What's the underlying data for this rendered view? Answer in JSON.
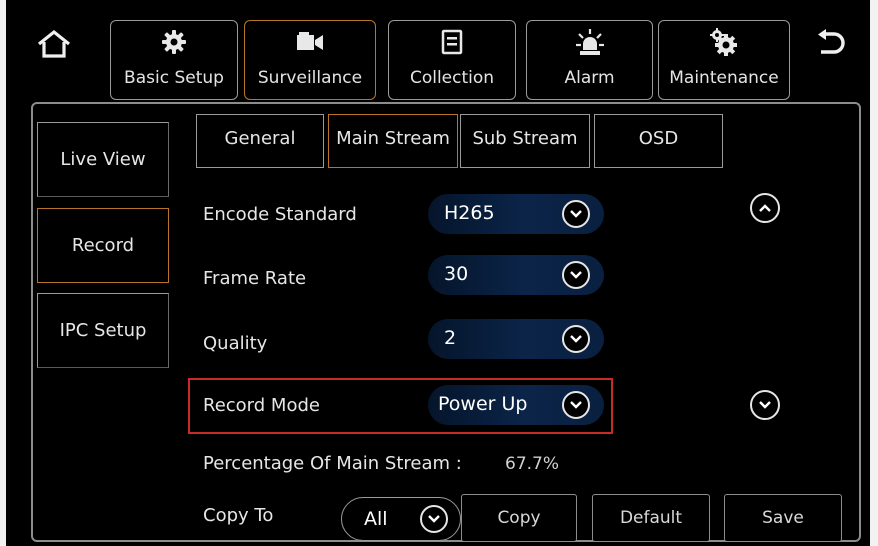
{
  "toolbar": {
    "tabs": [
      {
        "label": "Basic Setup",
        "icon": "gear-icon"
      },
      {
        "label": "Surveillance",
        "icon": "camera-icon"
      },
      {
        "label": "Collection",
        "icon": "document-icon"
      },
      {
        "label": "Alarm",
        "icon": "alarm-light-icon"
      },
      {
        "label": "Maintenance",
        "icon": "gears-icon"
      }
    ],
    "active_tab": "Surveillance"
  },
  "sidebar": {
    "items": [
      {
        "label": "Live View"
      },
      {
        "label": "Record"
      },
      {
        "label": "IPC Setup"
      }
    ],
    "active": "Record"
  },
  "subtabs": [
    {
      "label": "General"
    },
    {
      "label": "Main Stream"
    },
    {
      "label": "Sub Stream"
    },
    {
      "label": "OSD"
    }
  ],
  "active_subtab": "Main Stream",
  "settings": {
    "encode_standard": {
      "label": "Encode Standard",
      "value": "H265"
    },
    "frame_rate": {
      "label": "Frame Rate",
      "value": "30"
    },
    "quality": {
      "label": "Quality",
      "value": "2"
    },
    "record_mode": {
      "label": "Record Mode",
      "value": "Power Up"
    },
    "percentage_label": "Percentage Of Main Stream :",
    "percentage_value": "67.7%"
  },
  "copy_to": {
    "label": "Copy To",
    "value": "All"
  },
  "buttons": {
    "copy": "Copy",
    "default": "Default",
    "save": "Save"
  },
  "colors": {
    "background": "#000000",
    "active_border": "#b8752a",
    "highlight_border": "#c82a2a",
    "select_fill": "#0b2448",
    "text": "#e6e6e6"
  }
}
